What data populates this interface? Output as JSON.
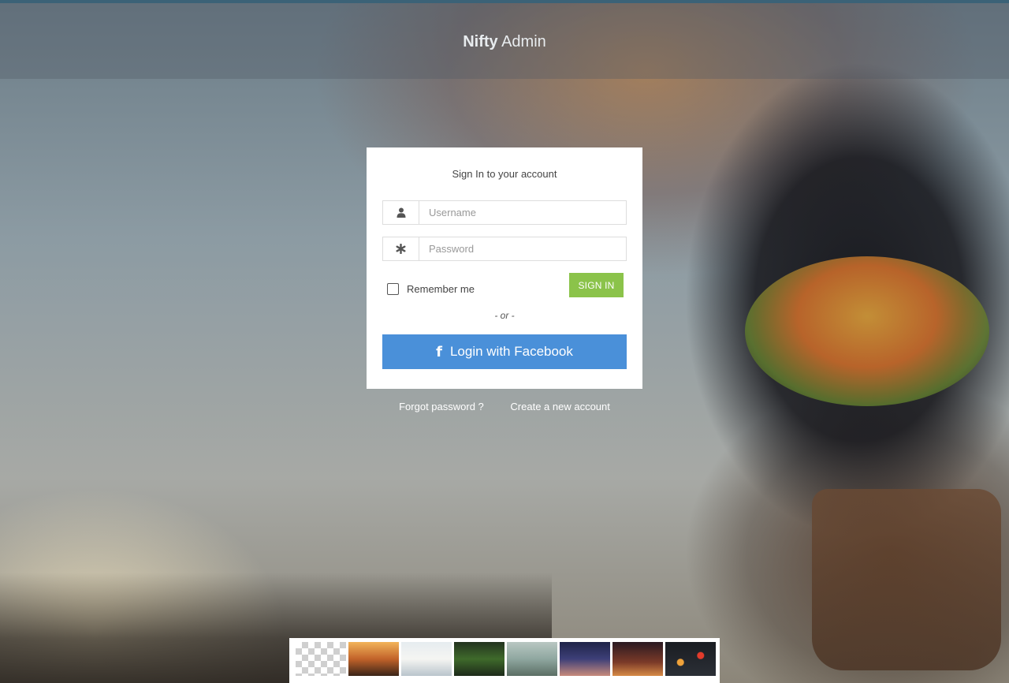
{
  "app": {
    "brand_bold": "Nifty",
    "brand_light": "Admin"
  },
  "login": {
    "title": "Sign In to your account",
    "username_placeholder": "Username",
    "password_placeholder": "Password",
    "remember_label": "Remember me",
    "signin_label": "SIGN IN",
    "or_label": "- or -",
    "facebook_icon": "f",
    "facebook_label": "Login with Facebook"
  },
  "links": {
    "forgot": "Forgot password ?",
    "create": "Create a new account"
  },
  "colors": {
    "signin_button": "#8bc34a",
    "facebook_button": "#4a90d9",
    "header_accent": "#3b6277"
  },
  "icons": {
    "username": "user-icon",
    "password": "asterisk-icon",
    "facebook": "facebook-icon"
  },
  "background_thumbnails": [
    "transparent-thumbnail",
    "sunset-track-thumbnail",
    "balloon-thumbnail",
    "forest-thumbnail",
    "lake-pier-thumbnail",
    "bridge-night-thumbnail",
    "dusk-hills-thumbnail",
    "bokeh-lights-thumbnail"
  ]
}
